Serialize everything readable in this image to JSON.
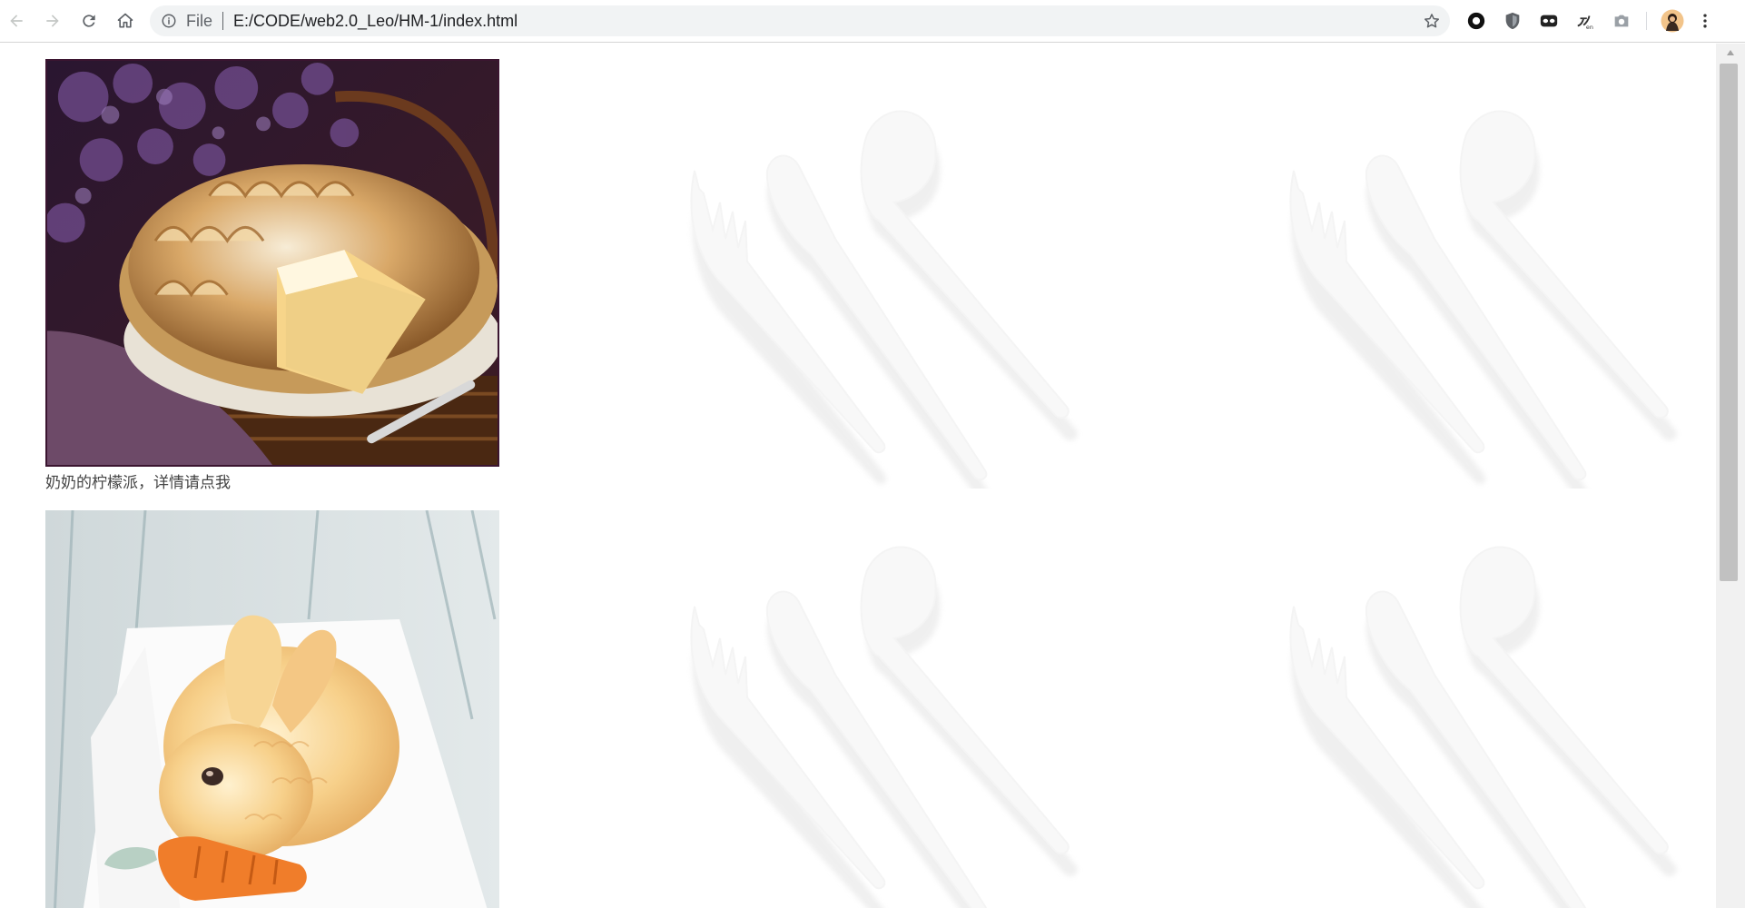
{
  "browser": {
    "back_label": "Back",
    "forward_label": "Forward",
    "reload_label": "Reload",
    "home_label": "Home",
    "omnibox": {
      "scheme": "File",
      "url": "E:/CODE/web2.0_Leo/HM-1/index.html"
    },
    "extensions": [
      "circle-extension-icon",
      "shield-extension-icon",
      "mask-extension-icon",
      "translate-extension-icon",
      "camera-extension-icon"
    ],
    "profile": "avatar"
  },
  "page": {
    "items": [
      {
        "caption": "奶奶的柠檬派，详情请点我",
        "photo": "lemon-meringue-pie"
      },
      {
        "caption": "",
        "photo": "bunny-dessert"
      }
    ],
    "background_pattern": "cutlery"
  },
  "colors": {
    "pie_border": "#3b1530",
    "caption_text": "#444444",
    "toolbar_bg": "#ffffff",
    "omnibox_bg": "#f1f3f4"
  }
}
